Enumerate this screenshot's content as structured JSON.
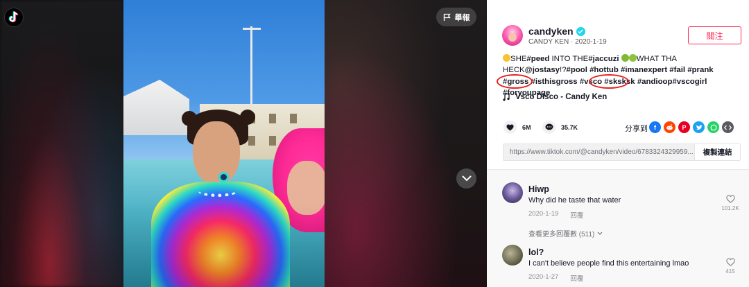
{
  "header": {
    "report_label": "舉報"
  },
  "author": {
    "username": "candyken",
    "nickname": "CANDY KEN",
    "date": "2020-1-19",
    "follow_label": "關注"
  },
  "description": {
    "parts": [
      {
        "t": "SHE",
        "tag": false
      },
      {
        "t": "#peed",
        "tag": true
      },
      {
        "t": " INTO THE",
        "tag": false
      },
      {
        "t": "#jaccuzi",
        "tag": true
      },
      {
        "t": "WHAT THA HECK",
        "tag": false
      },
      {
        "t": "@jostasy",
        "tag": true
      },
      {
        "t": "!?",
        "tag": false
      },
      {
        "t": "#pool",
        "tag": true
      },
      {
        "t": "#hottub",
        "tag": true
      },
      {
        "t": "#imanexpert",
        "tag": true
      },
      {
        "t": "#fail",
        "tag": true
      },
      {
        "t": "#prank",
        "tag": true
      },
      {
        "t": "#gross",
        "tag": true
      },
      {
        "t": "#isthisgross",
        "tag": true
      },
      {
        "t": "#vsco",
        "tag": true
      },
      {
        "t": "#sksksk",
        "tag": true
      },
      {
        "t": "#andioop",
        "tag": true
      },
      {
        "t": "#vscogirl",
        "tag": true
      },
      {
        "t": "#foryoupage",
        "tag": true
      }
    ]
  },
  "music": {
    "title": "Vsco Disco - Candy Ken"
  },
  "stats": {
    "likes": "6M",
    "comments": "35.7K"
  },
  "share": {
    "label": "分享到",
    "icons": [
      "facebook-icon",
      "reddit-icon",
      "pinterest-icon",
      "twitter-icon",
      "whatsapp-icon",
      "embed-icon"
    ],
    "colors": {
      "facebook": "#1877f2",
      "reddit": "#ff4500",
      "pinterest": "#e60023",
      "twitter": "#1da1f2",
      "whatsapp": "#25d366",
      "embed": "#5a5b60"
    }
  },
  "link": {
    "url": "https://www.tiktok.com/@candyken/video/6783324329959...",
    "copy_label": "複製連結"
  },
  "comments": [
    {
      "name": "Hiwp",
      "text": "Why did he taste that water",
      "date": "2020-1-19",
      "reply_label": "回覆",
      "likes": "101.2K",
      "more_replies": "查看更多回覆數 (511)"
    },
    {
      "name": "lol?",
      "text": "I can't believe people find this entertaining lmao",
      "date": "2020-1-27",
      "reply_label": "回覆",
      "likes": "415"
    }
  ],
  "colors": {
    "accent": "#fe2c55",
    "verified": "#20d5ec",
    "annotation_circle": "#e3201b"
  }
}
